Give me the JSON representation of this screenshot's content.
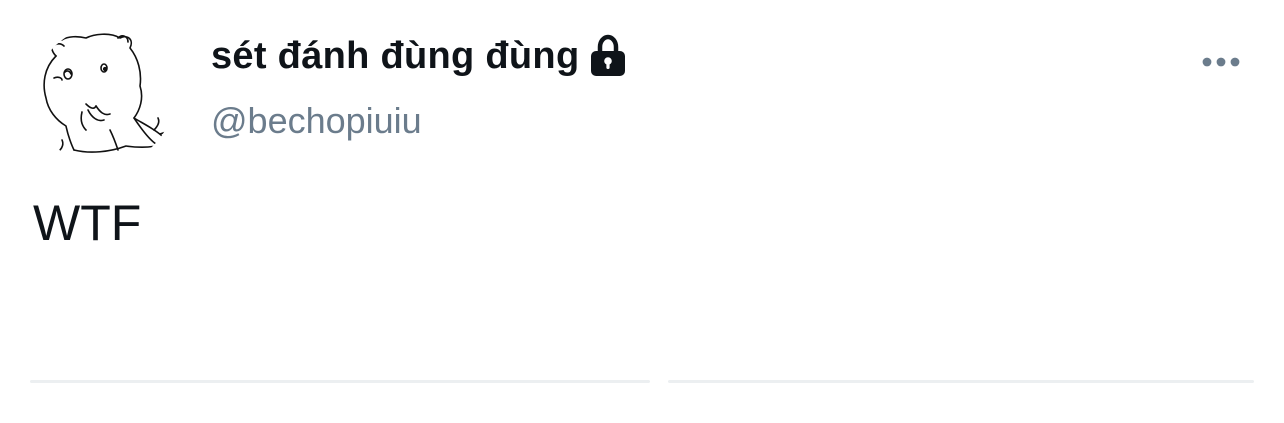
{
  "tweet": {
    "display_name": "sét đánh đùng đùng",
    "handle": "@bechopiuiu",
    "text": "WTF",
    "protected": true
  },
  "icons": {
    "avatar": "hamster-sketch-avatar",
    "protected": "lock-icon",
    "more": "more-options-icon"
  },
  "colors": {
    "name": "#0f1419",
    "handle": "#6b7c8c",
    "more_dots": "#6b7c8c",
    "divider": "#eceff1",
    "background": "#ffffff"
  }
}
